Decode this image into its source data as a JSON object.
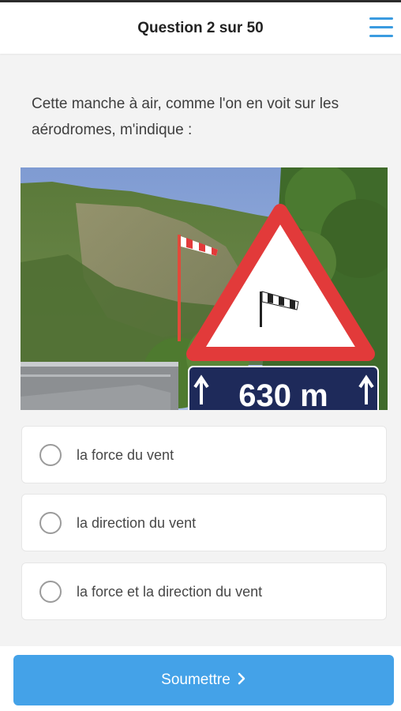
{
  "header": {
    "title": "Question 2 sur 50",
    "menu_icon": "hamburger-menu-icon"
  },
  "question": {
    "text": "Cette manche à air, comme l'on en voit sur les aérodromes, m'indique :"
  },
  "illustration": {
    "sign_distance": "630 m",
    "colors": {
      "sky": "#8aa6d8",
      "sign_red": "#e23a3a",
      "panel": "#1e2a5a"
    }
  },
  "answers": [
    {
      "label": "la force du vent",
      "selected": false
    },
    {
      "label": "la direction du vent",
      "selected": false
    },
    {
      "label": "la force et la direction du vent",
      "selected": false
    }
  ],
  "footer": {
    "submit_label": "Soumettre",
    "submit_icon": "chevron-right-icon",
    "accent": "#44a2e8"
  }
}
